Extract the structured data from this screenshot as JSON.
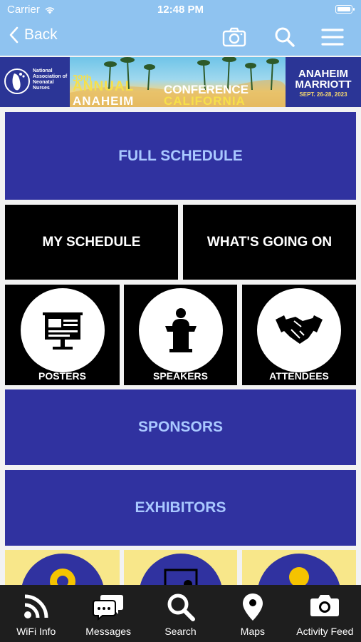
{
  "status": {
    "carrier": "Carrier",
    "time": "12:48 PM"
  },
  "nav": {
    "back_label": "Back"
  },
  "banner": {
    "org_line1": "National",
    "org_line2": "Association of",
    "org_line3": "Neonatal",
    "org_line4": "Nurses",
    "edition": "39th",
    "annual": "ANNUAL",
    "conference": "CONFERENCE",
    "anaheim": "ANAHEIM",
    "california": "CALIFORNIA",
    "venue_city": "ANAHEIM",
    "venue_hotel": "MARRIOTT",
    "dates": "SEPT. 26-28, 2023"
  },
  "tiles": {
    "full_schedule": "FULL SCHEDULE",
    "my_schedule": "MY SCHEDULE",
    "whats_going_on": "WHAT'S GOING ON",
    "posters": "POSTERS",
    "speakers": "SPEAKERS",
    "attendees": "ATTENDEES",
    "sponsors": "SPONSORS",
    "exhibitors": "EXHIBITORS"
  },
  "tabbar": {
    "wifi": "WiFi Info",
    "messages": "Messages",
    "search": "Search",
    "maps": "Maps",
    "activity": "Activity Feed"
  },
  "colors": {
    "nav": "#8fc3f0",
    "tile_blue": "#3032a0",
    "tile_text": "#a9c8ff",
    "tile_black": "#000000",
    "tile_yellow": "#f8e78a"
  },
  "icons": [
    "wifi-icon",
    "chevron-left-icon",
    "camera-icon",
    "search-icon",
    "menu-icon",
    "presentation-board-icon",
    "podium-icon",
    "handshake-icon",
    "gear-info-icon",
    "certificate-icon",
    "award-ribbon-icon",
    "rss-icon",
    "chat-bubbles-icon",
    "map-pin-icon"
  ]
}
